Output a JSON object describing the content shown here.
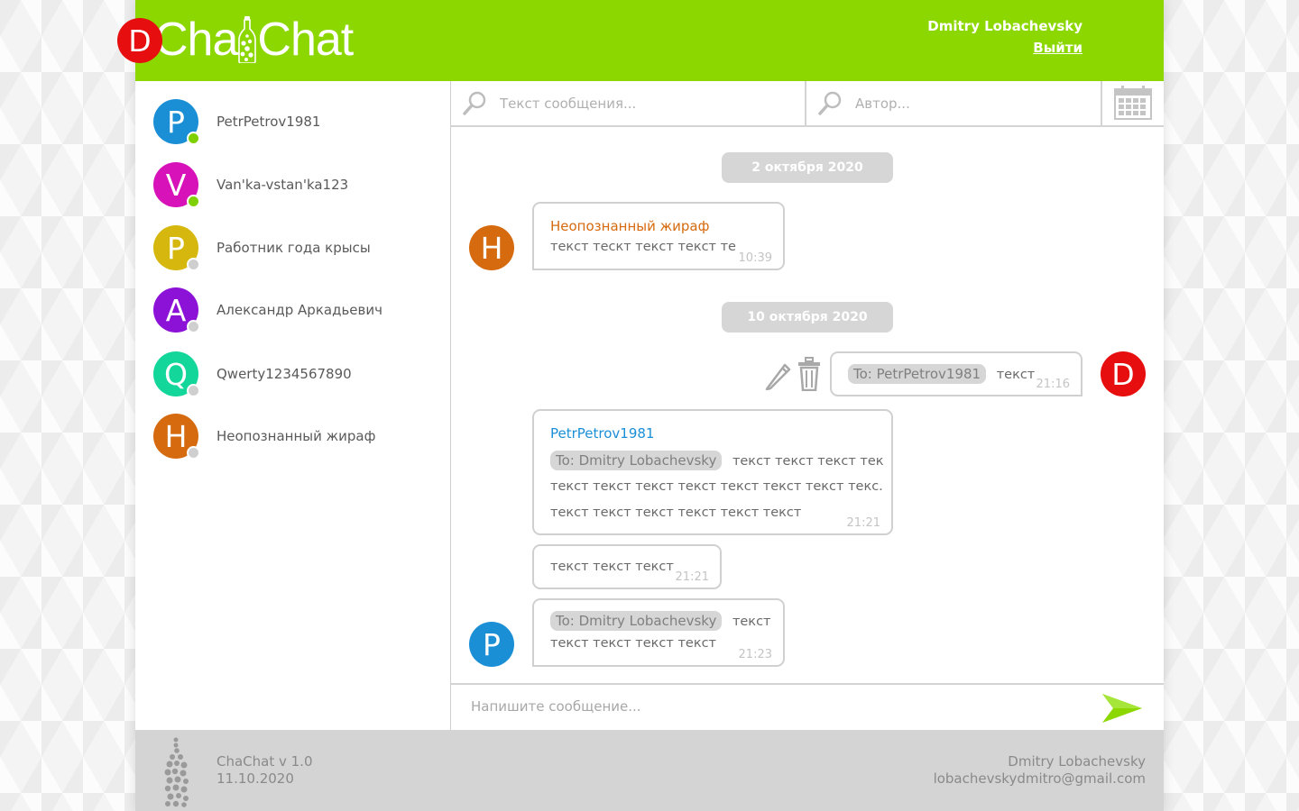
{
  "app": {
    "logo_left": "Cha",
    "logo_right": "Chat",
    "accent": "#8cd700"
  },
  "user": {
    "name": "Dmitry Lobachevsky",
    "logout": "Выйти",
    "avatar_letter": "D",
    "avatar_color": "#e60e0e"
  },
  "contacts": [
    {
      "letter": "P",
      "name": "PetrPetrov1981",
      "color": "#1a8fd6",
      "status": "online"
    },
    {
      "letter": "V",
      "name": "Van'ka-vstan'ka123",
      "color": "#d612b8",
      "status": "online"
    },
    {
      "letter": "P",
      "name": "Работник года крысы",
      "color": "#d6b70e",
      "status": "offline"
    },
    {
      "letter": "A",
      "name": "Александр Аркадьевич",
      "color": "#8b12d6",
      "status": "offline"
    },
    {
      "letter": "Q",
      "name": "Qwerty1234567890",
      "color": "#12d69a",
      "status": "offline"
    },
    {
      "letter": "H",
      "name": "Неопознанный жираф",
      "color": "#d66a0e",
      "status": "offline"
    }
  ],
  "search": {
    "text_placeholder": "Текст сообщения...",
    "author_placeholder": "Автор..."
  },
  "dates": [
    "2 октября 2020",
    "10 октября 2020"
  ],
  "messages": {
    "m1": {
      "author": "Неопознанный жираф",
      "author_color": "#d66a0e",
      "avatar_letter": "H",
      "text": "текст теcкт текст текст те",
      "time": "10:39"
    },
    "m2": {
      "to": "To: PetrPetrov1981",
      "text": "текст",
      "time": "21:16",
      "avatar_letter": "D"
    },
    "m3": {
      "author": "PetrPetrov1981",
      "author_color": "#1a8fd6",
      "to": "To: Dmitry Lobachevsky",
      "line1": "текст текст текст тек",
      "line2": "текст текст текст текст текст текст текст текс.",
      "line3": "текст текст текст текст текст текст",
      "time": "21:21"
    },
    "m4": {
      "text": "текст текст текст",
      "time": "21:21"
    },
    "m5": {
      "to": "To: Dmitry Lobachevsky",
      "text": "текст",
      "line2": "текст текст текст текст",
      "time": "21:23",
      "avatar_letter": "P"
    }
  },
  "composer": {
    "placeholder": "Напишите сообщение..."
  },
  "footer": {
    "app_version": "ChaChat v 1.0",
    "date": "11.10.2020",
    "author": "Dmitry Lobachevsky",
    "email": "lobachevskydmitro@gmail.com"
  },
  "icons": {
    "search": "search-icon",
    "calendar": "calendar-icon",
    "edit": "pencil-icon",
    "delete": "trash-icon",
    "send": "send-arrow-icon",
    "logo": "bottle-logo-icon"
  }
}
